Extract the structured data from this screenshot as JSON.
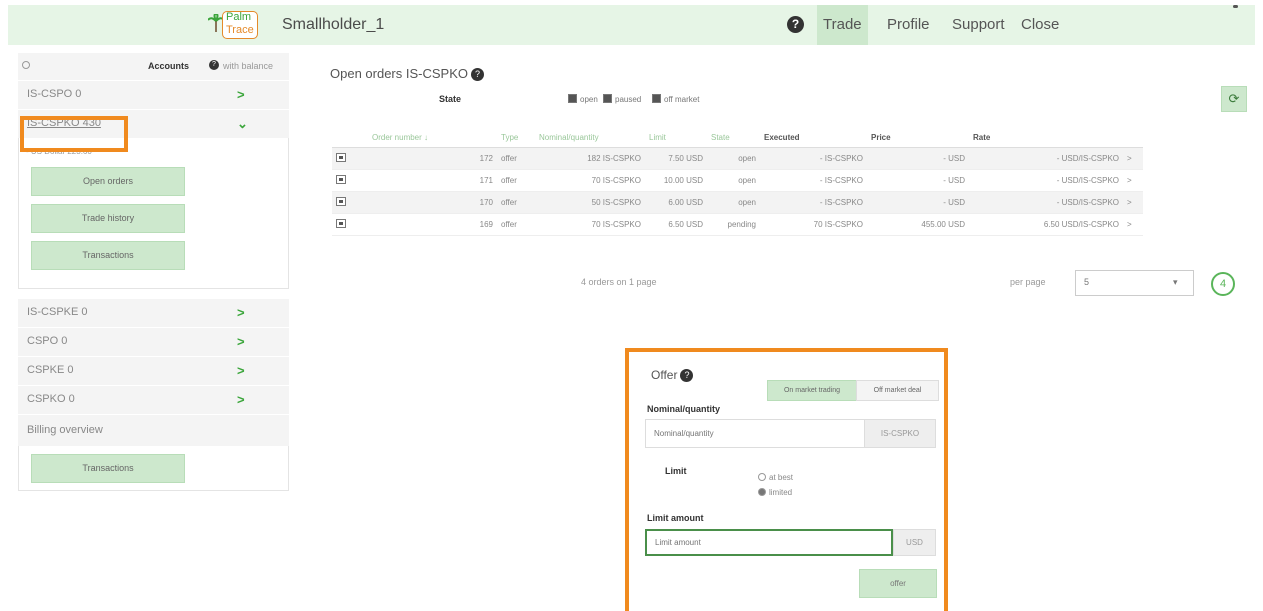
{
  "header": {
    "logo_line1": "Palm",
    "logo_line2": "Trace",
    "account_name": "Smallholder_1",
    "help_icon": "question-circle-icon",
    "nav": [
      "Trade",
      "Profile",
      "Support",
      "Close"
    ],
    "active_nav": "Trade"
  },
  "sidebar": {
    "search_icon": "search-icon",
    "accounts_label": "Accounts",
    "with_balance_label": "with balance",
    "accounts": [
      {
        "label": "IS-CSPO 0"
      },
      {
        "label": "IS-CSPKO 430"
      },
      {
        "label": "IS-CSPKE 0"
      },
      {
        "label": "CSPO 0"
      },
      {
        "label": "CSPKE 0"
      },
      {
        "label": "CSPKO 0"
      }
    ],
    "expanded_sub": "- US Dollar 223.60",
    "expanded_buttons": [
      "Open orders",
      "Trade history",
      "Transactions"
    ],
    "billing_label": "Billing overview",
    "billing_button": "Transactions"
  },
  "orders": {
    "title": "Open orders IS-CSPKO",
    "state_label": "State",
    "state_filters": [
      "open",
      "paused",
      "off market"
    ],
    "columns": [
      "Order number",
      "Type",
      "Nominal/quantity",
      "Limit",
      "State",
      "Executed",
      "Price",
      "Rate"
    ],
    "rows": [
      {
        "number": "172",
        "type": "offer",
        "quantity": "182 IS-CSPKO",
        "limit": "7.50 USD",
        "state": "open",
        "executed": "- IS-CSPKO",
        "price": "- USD",
        "rate": "- USD/IS-CSPKO"
      },
      {
        "number": "171",
        "type": "offer",
        "quantity": "70 IS-CSPKO",
        "limit": "10.00 USD",
        "state": "open",
        "executed": "- IS-CSPKO",
        "price": "- USD",
        "rate": "- USD/IS-CSPKO"
      },
      {
        "number": "170",
        "type": "offer",
        "quantity": "50 IS-CSPKO",
        "limit": "6.00 USD",
        "state": "open",
        "executed": "- IS-CSPKO",
        "price": "- USD",
        "rate": "- USD/IS-CSPKO"
      },
      {
        "number": "169",
        "type": "offer",
        "quantity": "70 IS-CSPKO",
        "limit": "6.50 USD",
        "state": "pending",
        "executed": "70 IS-CSPKO",
        "price": "455.00 USD",
        "rate": "6.50 USD/IS-CSPKO"
      }
    ],
    "pager_text": "4 orders on 1 page",
    "per_page_label": "per page",
    "per_page_value": "5",
    "page_number": "4"
  },
  "offer": {
    "title": "Offer",
    "tab_on": "On market trading",
    "tab_off": "Off market deal",
    "quantity_label": "Nominal/quantity",
    "quantity_placeholder": "Nominal/quantity",
    "quantity_unit": "IS-CSPKO",
    "limit_label": "Limit",
    "limit_options": [
      "at best",
      "limited"
    ],
    "limit_selected": "limited",
    "limit_amount_label": "Limit amount",
    "limit_amount_placeholder": "Limit amount",
    "limit_amount_unit": "USD",
    "submit_label": "offer"
  },
  "colors": {
    "accent_green": "#3aa53a",
    "highlight_orange": "#f08a1e",
    "header_bg": "#e6f5e6",
    "button_bg": "#cde8cd"
  }
}
